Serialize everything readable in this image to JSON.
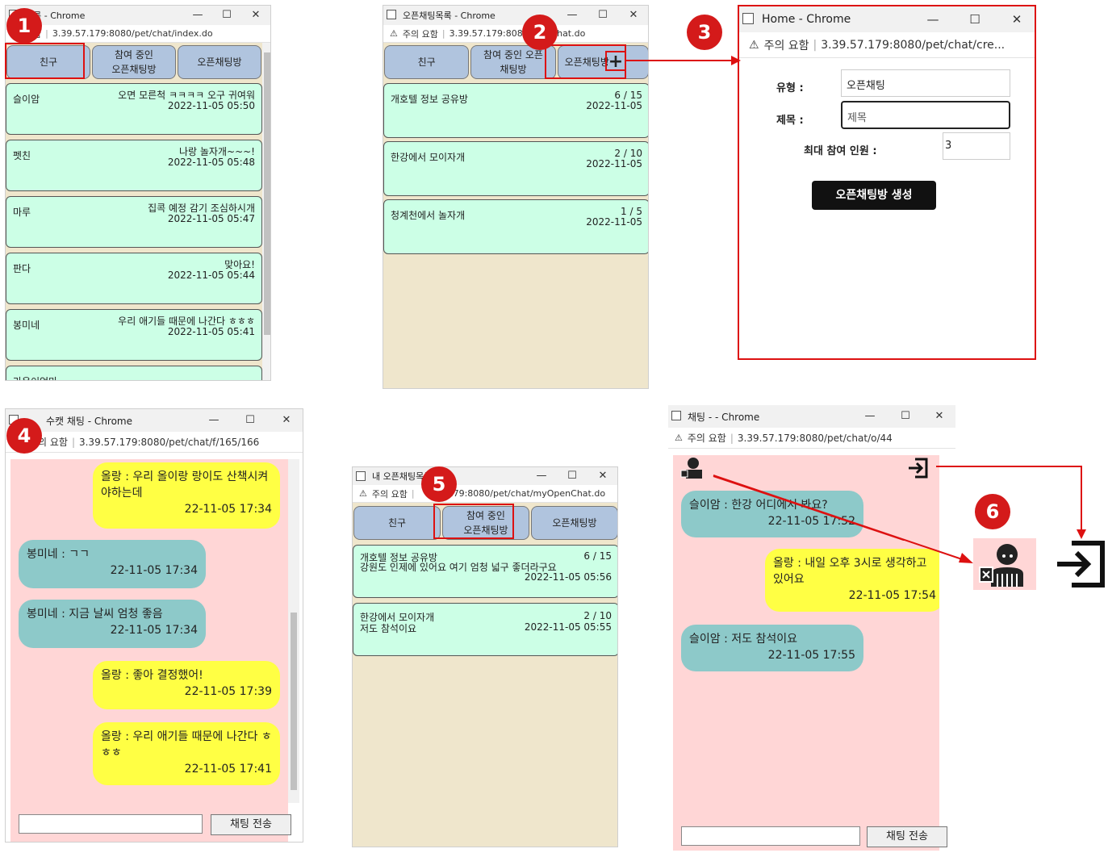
{
  "badges": [
    "1",
    "2",
    "3",
    "4",
    "5",
    "6"
  ],
  "window_controls": {
    "minimize": "—",
    "maximize": "☐",
    "close": "✕"
  },
  "addr_warning": "⚠",
  "p1": {
    "title": "목록 - Chrome",
    "warning": "요함",
    "url": "3.39.57.179:8080/pet/chat/index.do",
    "tabs": [
      "친구",
      "참여 중인\n오픈채팅방",
      "오픈채팅방"
    ],
    "items": [
      {
        "name": "슬이암",
        "msg": "오면 모른척 ㅋㅋㅋㅋ 오구 귀여워",
        "time": "2022-11-05 05:50"
      },
      {
        "name": "펫친",
        "msg": "나랑 놀자개~~~!",
        "time": "2022-11-05 05:48"
      },
      {
        "name": "마루",
        "msg": "집콕 예정 감기 조심하시개",
        "time": "2022-11-05 05:47"
      },
      {
        "name": "판다",
        "msg": "맞아요!",
        "time": "2022-11-05 05:44"
      },
      {
        "name": "봉미네",
        "msg": "우리 애기들 때문에 나간다 ㅎㅎㅎ",
        "time": "2022-11-05 05:41"
      },
      {
        "name": "라온이엄마",
        "msg": "",
        "time": ""
      }
    ]
  },
  "p2": {
    "title": "오픈채팅목록 - Chrome",
    "warning": "주의 요함",
    "url": "3.39.57.179:808  /openChat.do",
    "tabs": [
      "친구",
      "참여 중인 오픈\n채팅방",
      "오픈채팅방"
    ],
    "plus": "+",
    "items": [
      {
        "name": "개호텔 정보 공유방",
        "count": "6 / 15",
        "date": "2022-11-05"
      },
      {
        "name": "한강에서 모이자개",
        "count": "2 / 10",
        "date": "2022-11-05"
      },
      {
        "name": "청계천에서 놀자개",
        "count": "1 / 5",
        "date": "2022-11-05"
      }
    ]
  },
  "p3": {
    "title": "Home - Chrome",
    "warning": "주의 요함",
    "url": "3.39.57.179:8080/pet/chat/cre...",
    "type_label": "유형 :",
    "type_value": "오픈채팅",
    "title_label": "제목 :",
    "title_placeholder": "제목",
    "max_label": "최대 참여 인원 :",
    "max_value": "3",
    "create_button": "오픈채팅방 생성"
  },
  "p4": {
    "title": "수캣 채팅 - Chrome",
    "warning": "의 요함",
    "url": "3.39.57.179:8080/pet/chat/f/165/166",
    "messages": [
      {
        "side": "right",
        "text": "올랑 : 우리 올이랑 랑이도 산책시켜야하는데",
        "time": "22-11-05 17:34"
      },
      {
        "side": "left",
        "text": "봉미네 : ㄱㄱ",
        "time": "22-11-05 17:34"
      },
      {
        "side": "left",
        "text": "봉미네 : 지금 날씨 엄청 좋음",
        "time": "22-11-05 17:34"
      },
      {
        "side": "right",
        "text": "올랑 : 좋아 결정했어!",
        "time": "22-11-05 17:39"
      },
      {
        "side": "right",
        "text": "올랑 : 우리 애기들 때문에 나간다 ㅎㅎㅎ",
        "time": "22-11-05 17:41"
      }
    ],
    "send_button": "채팅 전송"
  },
  "p5": {
    "title": "내 오픈채팅목록   me",
    "warning": "주의 요함",
    "url": "179:8080/pet/chat/myOpenChat.do",
    "tabs": [
      "친구",
      "참여 중인\n오픈채팅방",
      "오픈채팅방"
    ],
    "items": [
      {
        "name": "개호텔 정보 공유방",
        "last": "강원도 인제에 있어요 여기 엄청 넓구 좋더라구요",
        "count": "6 / 15",
        "time": "2022-11-05 05:56"
      },
      {
        "name": "한강에서 모이자개",
        "last": "저도 참석이요",
        "count": "2 / 10",
        "time": "2022-11-05 05:55"
      }
    ]
  },
  "p6": {
    "title": "채팅 - - Chrome",
    "warning": "주의 요함",
    "url": "3.39.57.179:8080/pet/chat/o/44",
    "messages": [
      {
        "side": "left",
        "text": "슬이암 : 한강 어디에서 봐요?",
        "time": "22-11-05 17:52"
      },
      {
        "side": "right",
        "text": "올랑 : 내일 오후 3시로 생각하고 있어요",
        "time": "22-11-05 17:54"
      },
      {
        "side": "left",
        "text": "슬이암 : 저도 참석이요",
        "time": "22-11-05 17:55"
      }
    ],
    "send_button": "채팅 전송"
  },
  "colors": {
    "tab": "#b0c4de",
    "item": "#ccffe6",
    "chat_bg": "#ffd6d6",
    "list_bg": "#efe6cc",
    "yellow_bubble": "#ffff44",
    "teal_bubble": "#8dc9c9",
    "annotation": "#dd1111"
  }
}
